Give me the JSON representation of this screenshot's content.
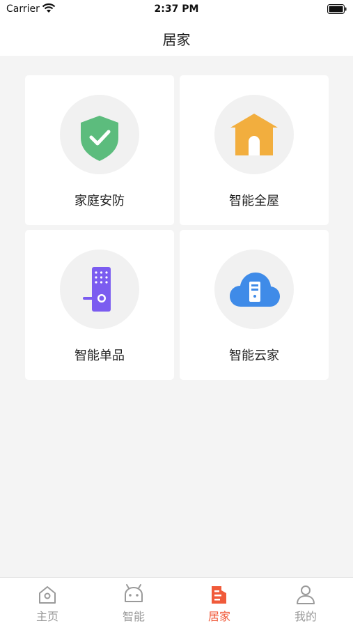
{
  "status": {
    "carrier": "Carrier",
    "time": "2:37 PM"
  },
  "nav": {
    "title": "居家"
  },
  "cards": [
    {
      "label": "家庭安防",
      "icon": "shield-check-icon",
      "color": "#5cbc7d"
    },
    {
      "label": "智能全屋",
      "icon": "house-icon",
      "color": "#f2ae3e"
    },
    {
      "label": "智能单品",
      "icon": "smart-lock-icon",
      "color": "#7b5cf0"
    },
    {
      "label": "智能云家",
      "icon": "cloud-server-icon",
      "color": "#3f8be8"
    }
  ],
  "tabs": [
    {
      "label": "主页",
      "icon": "home-icon",
      "active": false
    },
    {
      "label": "智能",
      "icon": "robot-icon",
      "active": false
    },
    {
      "label": "居家",
      "icon": "building-icon",
      "active": true
    },
    {
      "label": "我的",
      "icon": "user-icon",
      "active": false
    }
  ],
  "colors": {
    "accent": "#f05a3a",
    "inactive": "#9a9a9a"
  }
}
